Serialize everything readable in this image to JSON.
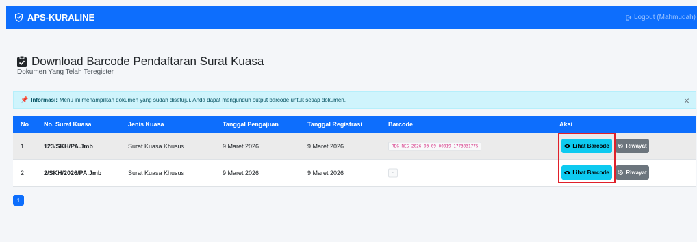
{
  "navbar": {
    "brand": "APS-KURALINE",
    "logout": "Logout (Mahmudah)"
  },
  "header": {
    "title": "Download Barcode Pendaftaran Surat Kuasa",
    "subtitle": "Dokumen Yang Telah Teregister"
  },
  "alert": {
    "label": "Informasi:",
    "text": "Menu ini menampilkan dokumen yang sudah disetujui. Anda dapat mengunduh output barcode untuk setiap dokumen.",
    "close": "×"
  },
  "table": {
    "columns": [
      "No",
      "No. Surat Kuasa",
      "Jenis Kuasa",
      "Tanggal Pengajuan",
      "Tanggal Registrasi",
      "Barcode",
      "Aksi"
    ],
    "rows": [
      {
        "no": "1",
        "nomor": "123/SKH/PA.Jmb",
        "jenis": "Surat Kuasa Khusus",
        "pengajuan": "9 Maret 2026",
        "registrasi": "9 Maret 2026",
        "barcode": "REG-REG-2026-03-09-00019-1773031775",
        "lihat": "Lihat Barcode",
        "riwayat": "Riwayat"
      },
      {
        "no": "2",
        "nomor": "2/SKH/2026/PA.Jmb",
        "jenis": "Surat Kuasa Khusus",
        "pengajuan": "9 Maret 2026",
        "registrasi": "9 Maret 2026",
        "barcode": "-",
        "lihat": "Lihat Barcode",
        "riwayat": "Riwayat"
      }
    ]
  },
  "pagination": {
    "current": "1"
  },
  "colors": {
    "primary": "#0d6efd",
    "info": "#0dcaf0",
    "secondary": "#6c757d",
    "highlight": "#e0202a"
  }
}
